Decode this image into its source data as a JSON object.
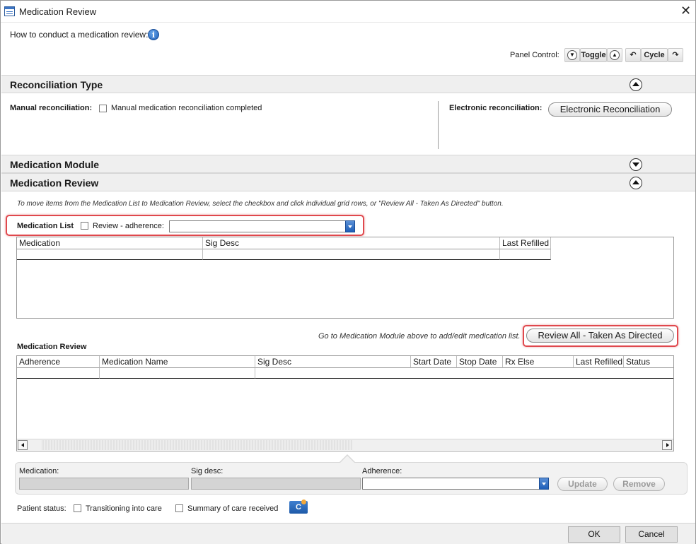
{
  "window": {
    "title": "Medication Review",
    "close_glyph": "✕"
  },
  "help": {
    "text": "How to conduct a medication review:",
    "icon": "info-icon",
    "icon_glyph": "i"
  },
  "panel_control": {
    "label": "Panel Control:",
    "toggle_label": "Toggle",
    "cycle_label": "Cycle",
    "down_glyph": "▼",
    "up_glyph": "▲",
    "undo_glyph": "↶",
    "redo_glyph": "↷"
  },
  "sections": {
    "reconciliation_type": "Reconciliation Type",
    "medication_module": "Medication Module",
    "medication_review": "Medication Review"
  },
  "reconciliation": {
    "manual_label": "Manual reconciliation:",
    "manual_checkbox_label": "Manual medication reconciliation completed",
    "electronic_label": "Electronic reconciliation:",
    "electronic_button": "Electronic Reconciliation"
  },
  "review": {
    "instruction": "To move items from the Medication List to Medication Review, select the checkbox and click individual grid rows, or \"Review All - Taken As Directed\" button.",
    "med_list_label": "Medication List",
    "review_adherence_label": "Review - adherence:",
    "adherence_value": "",
    "med_list_columns": [
      "Medication",
      "Sig Desc",
      "Last Refilled"
    ],
    "module_hint": "Go to Medication Module above to add/edit medication list.",
    "review_all_button": "Review All - Taken As Directed",
    "review_grid_title": "Medication Review",
    "review_columns": [
      "Adherence",
      "Medication Name",
      "Sig Desc",
      "Start Date",
      "Stop Date",
      "Rx Else",
      "Last Refilled",
      "Status"
    ]
  },
  "editor": {
    "medication_label": "Medication:",
    "sig_label": "Sig desc:",
    "adherence_label": "Adherence:",
    "medication_value": "",
    "sig_value": "",
    "adherence_value": "",
    "update_button": "Update",
    "remove_button": "Remove"
  },
  "patient_status": {
    "label": "Patient status:",
    "transitioning_label": "Transitioning into care",
    "summary_label": "Summary of care received",
    "cz_icon": "care-exchange-icon",
    "cz_glyph": "C"
  },
  "footer": {
    "ok_label": "OK",
    "cancel_label": "Cancel"
  },
  "colors": {
    "highlight_red": "#e0484d",
    "accent_blue": "#1f5fb8",
    "section_bg": "#efefef"
  }
}
